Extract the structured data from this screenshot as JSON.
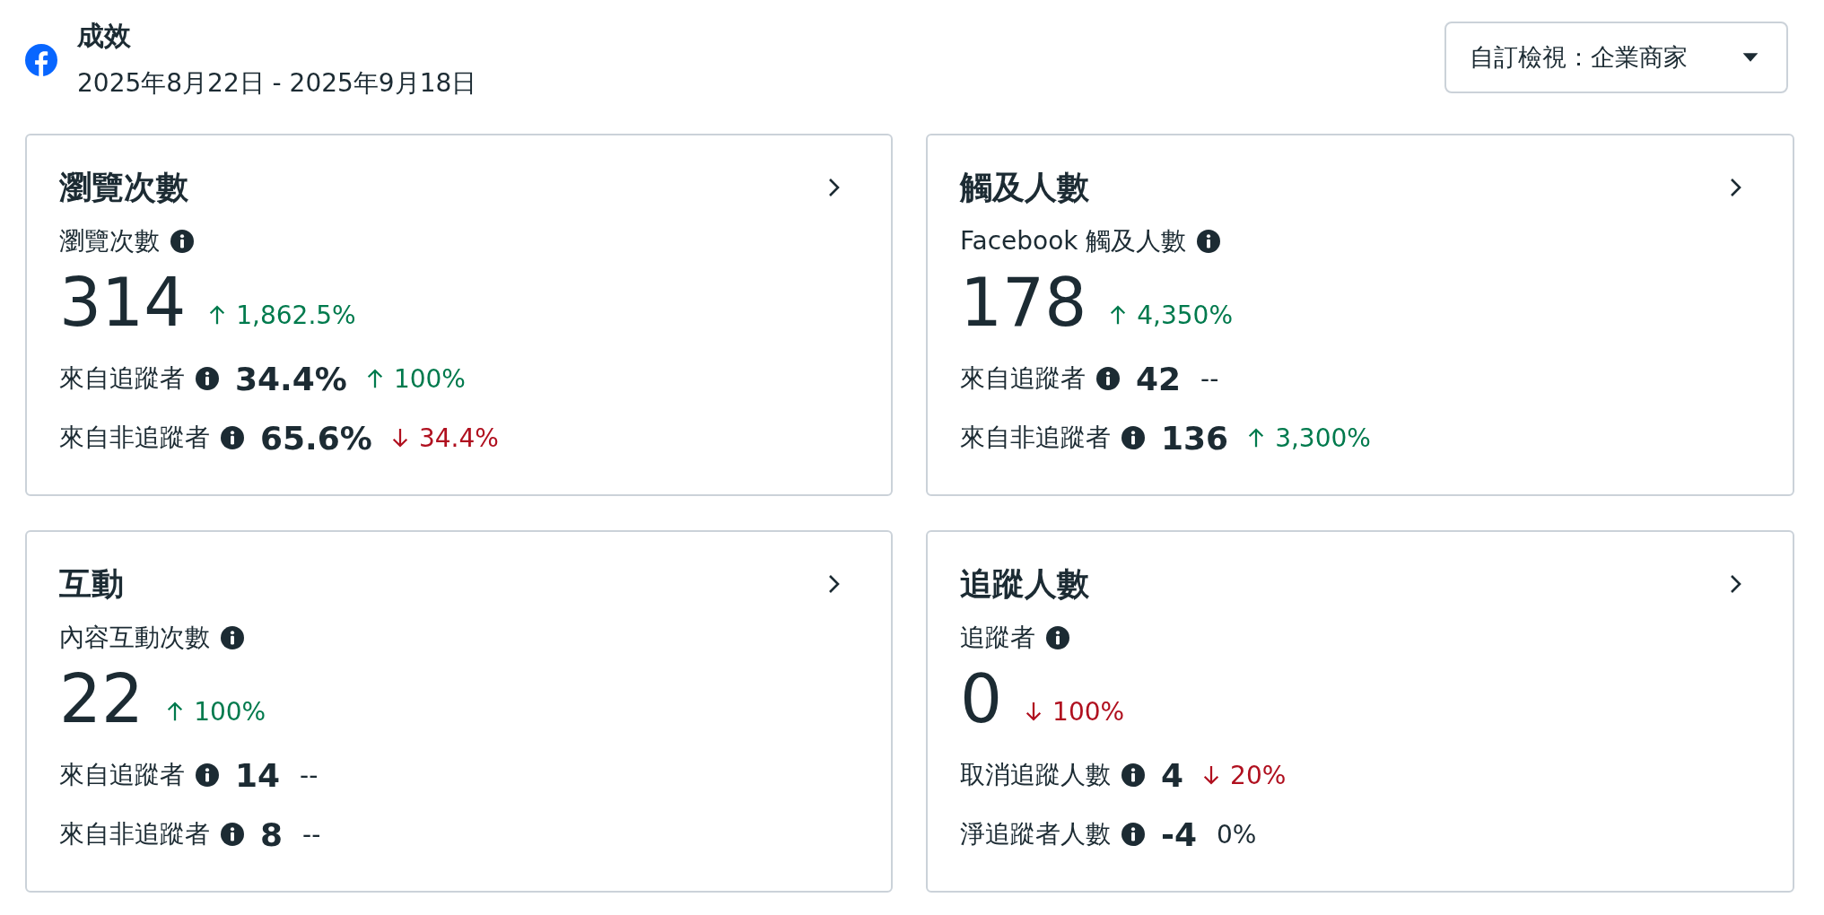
{
  "header": {
    "title": "成效",
    "date_range": "2025年8月22日 - 2025年9月18日",
    "view_dropdown": "自訂檢視：企業商家"
  },
  "cards": [
    {
      "title": "瀏覽次數",
      "metric_label": "瀏覽次數",
      "value": "314",
      "change": {
        "increase": true,
        "decrease": false,
        "text": "1,862.5%"
      },
      "rows": [
        {
          "label": "來自追蹤者",
          "value": "34.4%",
          "change": {
            "increase": true,
            "decrease": false,
            "text": "100%"
          }
        },
        {
          "label": "來自非追蹤者",
          "value": "65.6%",
          "change": {
            "increase": false,
            "decrease": true,
            "text": "34.4%"
          }
        }
      ]
    },
    {
      "title": "觸及人數",
      "metric_label": "Facebook 觸及人數",
      "value": "178",
      "change": {
        "increase": true,
        "decrease": false,
        "text": "4,350%"
      },
      "rows": [
        {
          "label": "來自追蹤者",
          "value": "42",
          "change": {
            "increase": false,
            "decrease": false,
            "text": "--"
          }
        },
        {
          "label": "來自非追蹤者",
          "value": "136",
          "change": {
            "increase": true,
            "decrease": false,
            "text": "3,300%"
          }
        }
      ]
    },
    {
      "title": "互動",
      "metric_label": "內容互動次數",
      "value": "22",
      "change": {
        "increase": true,
        "decrease": false,
        "text": "100%"
      },
      "rows": [
        {
          "label": "來自追蹤者",
          "value": "14",
          "change": {
            "increase": false,
            "decrease": false,
            "text": "--"
          }
        },
        {
          "label": "來自非追蹤者",
          "value": "8",
          "change": {
            "increase": false,
            "decrease": false,
            "text": "--"
          }
        }
      ]
    },
    {
      "title": "追蹤人數",
      "metric_label": "追蹤者",
      "value": "0",
      "change": {
        "increase": false,
        "decrease": true,
        "text": "100%"
      },
      "rows": [
        {
          "label": "取消追蹤人數",
          "value": "4",
          "change": {
            "increase": false,
            "decrease": true,
            "text": "20%"
          }
        },
        {
          "label": "淨追蹤者人數",
          "value": "-4",
          "change": {
            "increase": false,
            "decrease": false,
            "text": "0%"
          }
        }
      ]
    }
  ]
}
